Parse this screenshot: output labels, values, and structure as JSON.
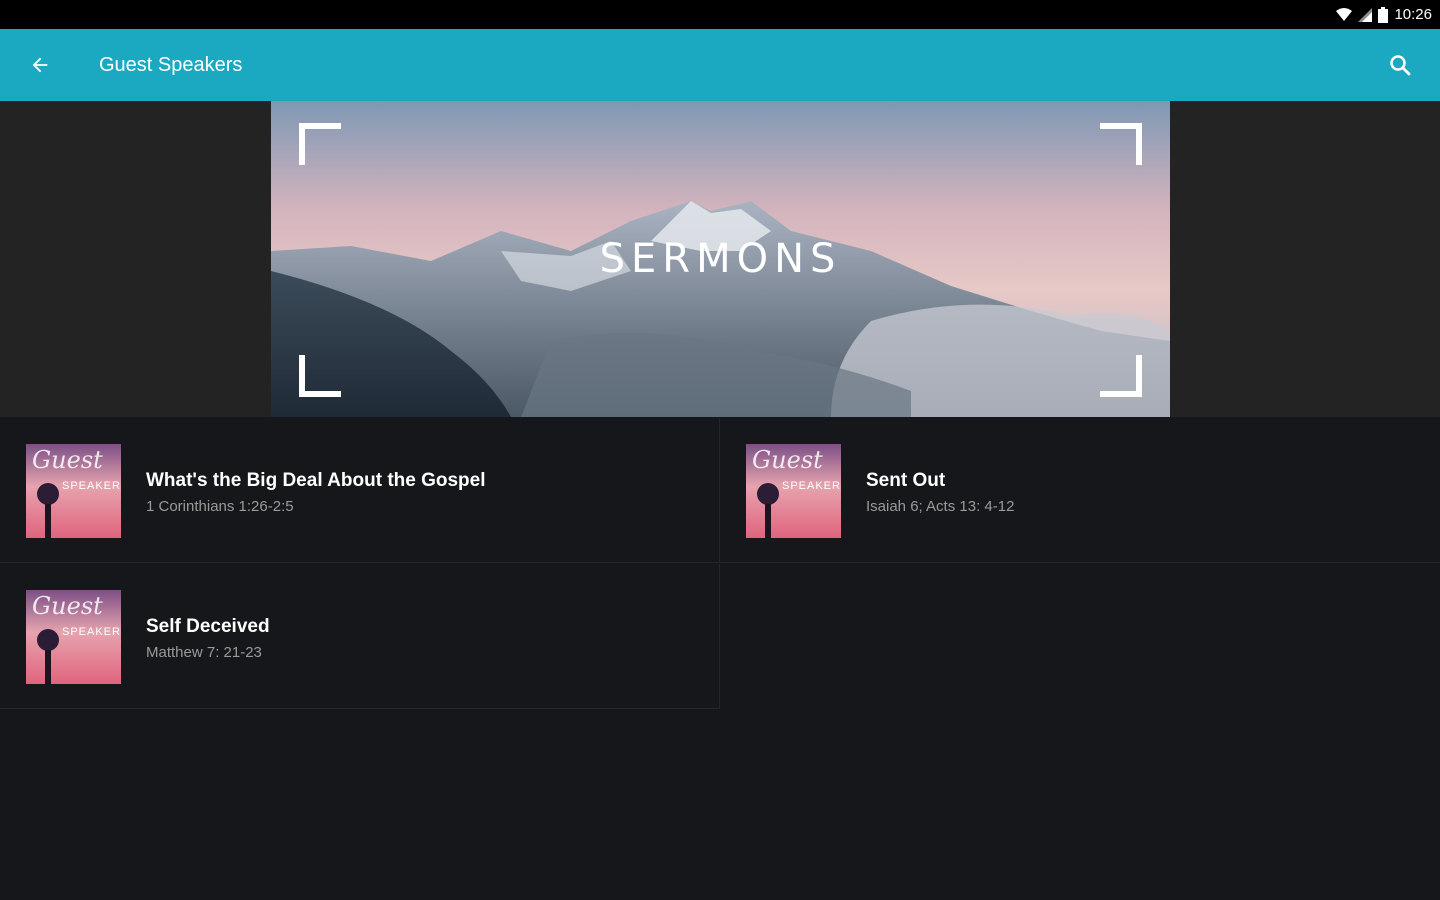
{
  "status_bar": {
    "time": "10:26",
    "icons": [
      "wifi-icon",
      "signal-icon",
      "battery-icon"
    ]
  },
  "app_bar": {
    "title": "Guest Speakers",
    "back_icon": "arrow-left-icon",
    "search_icon": "search-icon",
    "color": "#1ba8c1"
  },
  "banner": {
    "title": "SERMONS"
  },
  "sermons": [
    {
      "title": "What's the Big Deal About the Gospel",
      "reference": "1 Corinthians 1:26-2:5"
    },
    {
      "title": "Sent Out",
      "reference": "Isaiah 6; Acts 13: 4-12"
    },
    {
      "title": "Self Deceived",
      "reference": "Matthew 7: 21-23"
    }
  ],
  "thumbnail": {
    "script_text": "Guest",
    "caps_text": "SPEAKER"
  }
}
